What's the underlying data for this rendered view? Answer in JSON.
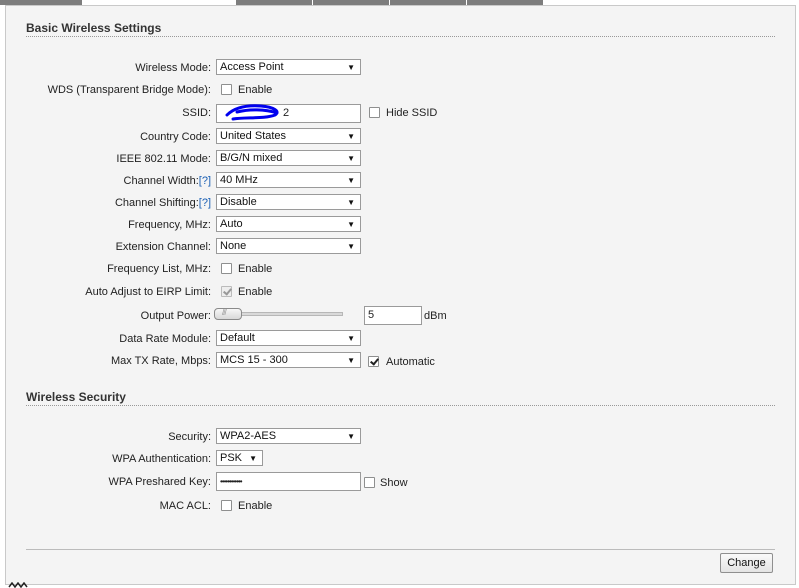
{
  "basic": {
    "title": "Basic Wireless Settings",
    "wireless_mode": {
      "label": "Wireless Mode:",
      "value": "Access Point"
    },
    "wds": {
      "label": "WDS (Transparent Bridge Mode):",
      "option": "Enable",
      "checked": false
    },
    "ssid": {
      "label": "SSID:",
      "value": "2",
      "hide_label": "Hide SSID",
      "hide_checked": false
    },
    "country_code": {
      "label": "Country Code:",
      "value": "United States"
    },
    "ieee_mode": {
      "label": "IEEE 802.11 Mode:",
      "value": "B/G/N mixed"
    },
    "channel_width": {
      "label": "Channel Width:",
      "help": "[?]",
      "value": "40 MHz"
    },
    "channel_shifting": {
      "label": "Channel Shifting:",
      "help": "[?]",
      "value": "Disable"
    },
    "frequency": {
      "label": "Frequency, MHz:",
      "value": "Auto"
    },
    "extension_channel": {
      "label": "Extension Channel:",
      "value": "None"
    },
    "frequency_list": {
      "label": "Frequency List, MHz:",
      "option": "Enable",
      "checked": false
    },
    "auto_adjust": {
      "label": "Auto Adjust to EIRP Limit:",
      "option": "Enable",
      "checked": true
    },
    "output_power": {
      "label": "Output Power:",
      "value": "5",
      "unit": "dBm",
      "slider_fraction": 0.0
    },
    "data_rate": {
      "label": "Data Rate Module:",
      "value": "Default"
    },
    "max_tx": {
      "label": "Max TX Rate, Mbps:",
      "value": "MCS 15 - 300",
      "auto_label": "Automatic",
      "auto_checked": true
    }
  },
  "security": {
    "title": "Wireless Security",
    "security": {
      "label": "Security:",
      "value": "WPA2-AES"
    },
    "wpa_auth": {
      "label": "WPA Authentication:",
      "value": "PSK"
    },
    "psk": {
      "label": "WPA Preshared Key:",
      "value": "••••••••••••",
      "show_label": "Show",
      "show_checked": false
    },
    "mac_acl": {
      "label": "MAC ACL:",
      "option": "Enable",
      "checked": false
    }
  },
  "footer": {
    "change_label": "Change"
  },
  "icons": {
    "dropdown": "triangle-down-icon",
    "redaction": "scribble",
    "corner": "handle-icon"
  },
  "colors": {
    "help_link": "#1a5fb4",
    "panel_bg": "#f4f4f4",
    "tab": "#7d7d7d",
    "scribble": "#0000ee"
  }
}
